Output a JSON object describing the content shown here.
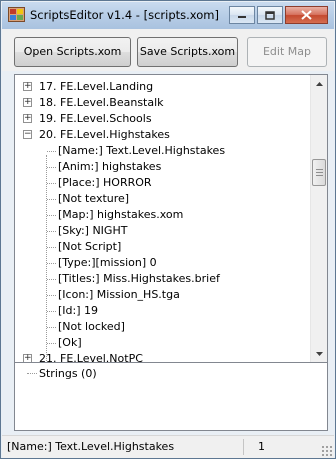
{
  "window": {
    "title": "ScriptsEditor v1.4 - [scripts.xom]"
  },
  "toolbar": {
    "open_label": "Open Scripts.xom",
    "save_label": "Save Scripts.xom",
    "edit_map_label": "Edit Map"
  },
  "tree": {
    "top_nodes": [
      {
        "label": "17. FE.Level.Landing",
        "expander": "+"
      },
      {
        "label": "18. FE.Level.Beanstalk",
        "expander": "+"
      },
      {
        "label": "19. FE.Level.Schools",
        "expander": "+"
      },
      {
        "label": "20. FE.Level.Highstakes",
        "expander": "−"
      }
    ],
    "children": [
      "[Name:] Text.Level.Highstakes",
      "[Anim:] highstakes",
      "[Place:] HORROR",
      "[Not texture]",
      "[Map:] highstakes.xom",
      "[Sky:] NIGHT",
      "[Not Script]",
      "[Type:][mission] 0",
      "[Titles:] Miss.Highstakes.brief",
      "[Icon:] Mission_HS.tga",
      "[Id:] 19",
      "[Not locked]",
      "[Ok]"
    ],
    "last_node": {
      "label": "21. FE.Level.NotPC",
      "expander": "+"
    }
  },
  "strings_panel": {
    "label": "Strings (0)"
  },
  "status": {
    "left": "[Name:] Text.Level.Highstakes",
    "right": "1"
  }
}
